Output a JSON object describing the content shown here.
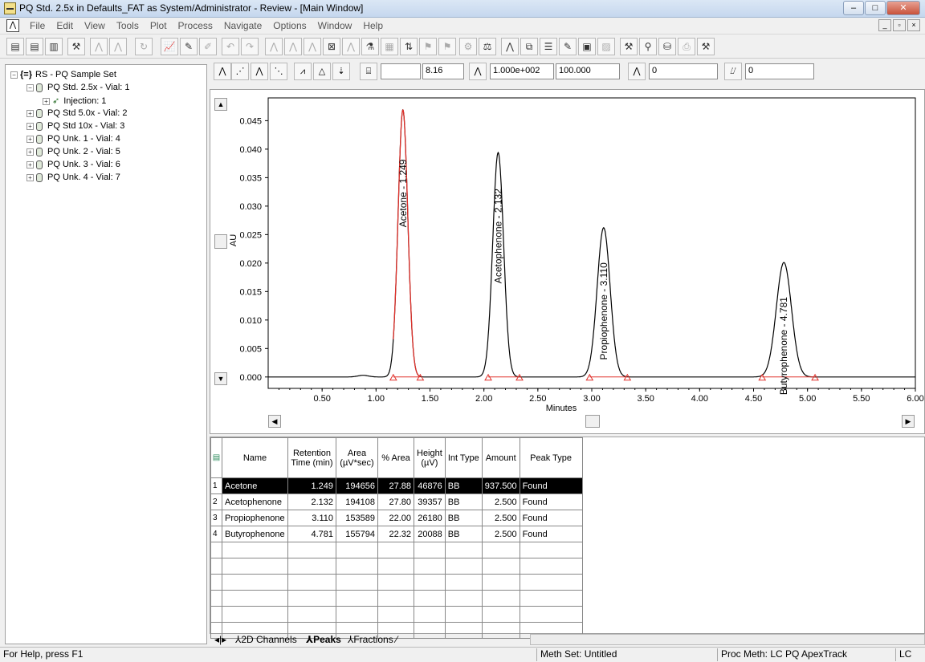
{
  "window": {
    "title": "PQ Std. 2.5x in Defaults_FAT as System/Administrator - Review - [Main Window]",
    "buttons": [
      "–",
      "□",
      "✕"
    ]
  },
  "menu": {
    "items": [
      "File",
      "Edit",
      "View",
      "Tools",
      "Plot",
      "Process",
      "Navigate",
      "Options",
      "Window",
      "Help"
    ]
  },
  "tree": {
    "root": "RS - PQ Sample Set",
    "items": [
      {
        "label": "PQ Std. 2.5x - Vial: 1",
        "expanded": true
      },
      {
        "label": "Injection: 1",
        "child": true
      },
      {
        "label": "PQ Std 5.0x - Vial: 2"
      },
      {
        "label": "PQ Std 10x - Vial: 3"
      },
      {
        "label": "PQ Unk. 1 - Vial: 4"
      },
      {
        "label": "PQ Unk. 2 - Vial: 5"
      },
      {
        "label": "PQ Unk. 3 - Vial: 6"
      },
      {
        "label": "PQ Unk. 4 - Vial: 7"
      }
    ]
  },
  "chart_toolbar": {
    "field1": "",
    "field2": "8.16",
    "field3": "1.000e+002",
    "field4": "100.000",
    "field5": "0",
    "field6": "0"
  },
  "chart_data": {
    "type": "line",
    "xlabel": "Minutes",
    "ylabel": "AU",
    "xlim": [
      0.0,
      6.0
    ],
    "ylim": [
      -0.002,
      0.049
    ],
    "xticks": [
      "0.50",
      "1.00",
      "1.50",
      "2.00",
      "2.50",
      "3.00",
      "3.50",
      "4.00",
      "4.50",
      "5.00",
      "5.50",
      "6.00"
    ],
    "yticks": [
      "0.000",
      "0.005",
      "0.010",
      "0.015",
      "0.020",
      "0.025",
      "0.030",
      "0.035",
      "0.040",
      "0.045"
    ],
    "peaks": [
      {
        "name": "Acetone - 1.249",
        "rt": 1.249,
        "height": 0.0469,
        "width": 0.045,
        "start": 1.16,
        "end": 1.41,
        "highlight": true
      },
      {
        "name": "Acetophenone - 2.132",
        "rt": 2.132,
        "height": 0.0394,
        "width": 0.05,
        "start": 2.04,
        "end": 2.33,
        "highlight": false
      },
      {
        "name": "Propiophenone - 3.110",
        "rt": 3.11,
        "height": 0.0262,
        "width": 0.06,
        "start": 2.98,
        "end": 3.33,
        "highlight": false
      },
      {
        "name": "Butyrophenone - 4.781",
        "rt": 4.781,
        "height": 0.0201,
        "width": 0.07,
        "start": 4.58,
        "end": 5.07,
        "highlight": false
      }
    ],
    "colors": {
      "trace": "#000000",
      "highlight": "#e0302a",
      "baseline": "#e0302a"
    }
  },
  "table": {
    "headers": [
      "Name",
      "Retention Time (min)",
      "Area (µV*sec)",
      "% Area",
      "Height (µV)",
      "Int Type",
      "Amount",
      "Peak Type"
    ],
    "rows": [
      [
        "Acetone",
        "1.249",
        "194656",
        "27.88",
        "46876",
        "BB",
        "937.500",
        "Found"
      ],
      [
        "Acetophenone",
        "2.132",
        "194108",
        "27.80",
        "39357",
        "BB",
        "2.500",
        "Found"
      ],
      [
        "Propiophenone",
        "3.110",
        "153589",
        "22.00",
        "26180",
        "BB",
        "2.500",
        "Found"
      ],
      [
        "Butyrophenone",
        "4.781",
        "155794",
        "22.32",
        "20088",
        "BB",
        "2.500",
        "Found"
      ]
    ],
    "empty_rows": 6
  },
  "tabs": [
    "2D Channels",
    "Peaks",
    "Fractions"
  ],
  "status": {
    "help": "For Help, press F1",
    "meth_set": "Meth Set: Untitled",
    "proc_meth": "Proc Meth: LC PQ ApexTrack",
    "mode": "LC"
  }
}
